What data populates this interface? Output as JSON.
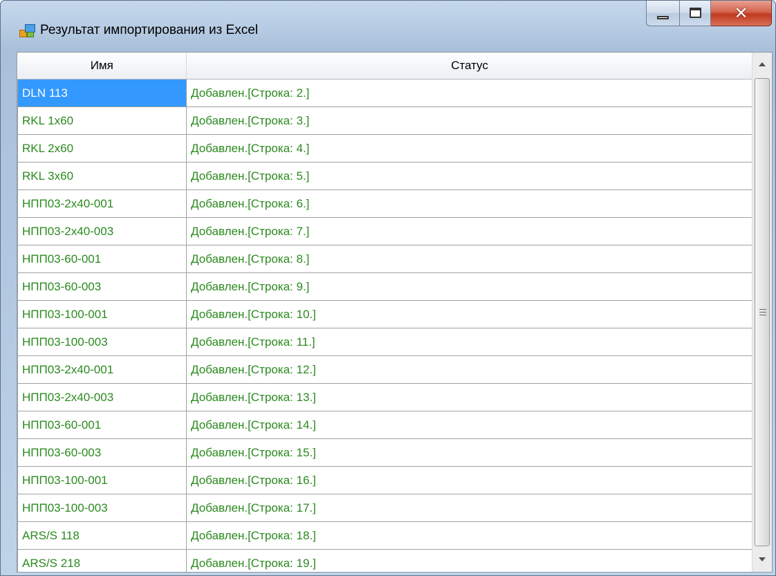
{
  "window": {
    "title": "Результат импортирования из Excel",
    "buttons": {
      "minimize": "minimize-icon",
      "maximize": "maximize-icon",
      "close": "✕"
    }
  },
  "grid": {
    "columns": [
      "Имя",
      "Статус"
    ],
    "selected_row": 0,
    "rows": [
      {
        "name": "DLN 113",
        "status": "Добавлен.[Строка: 2.]"
      },
      {
        "name": "RKL 1x60",
        "status": "Добавлен.[Строка: 3.]"
      },
      {
        "name": "RKL 2x60",
        "status": "Добавлен.[Строка: 4.]"
      },
      {
        "name": "RKL 3x60",
        "status": "Добавлен.[Строка: 5.]"
      },
      {
        "name": "НПП03-2x40-001",
        "status": "Добавлен.[Строка: 6.]"
      },
      {
        "name": "НПП03-2x40-003",
        "status": "Добавлен.[Строка: 7.]"
      },
      {
        "name": "НПП03-60-001",
        "status": "Добавлен.[Строка: 8.]"
      },
      {
        "name": "НПП03-60-003",
        "status": "Добавлен.[Строка: 9.]"
      },
      {
        "name": "НПП03-100-001",
        "status": "Добавлен.[Строка: 10.]"
      },
      {
        "name": "НПП03-100-003",
        "status": "Добавлен.[Строка: 11.]"
      },
      {
        "name": "НПП03-2x40-001",
        "status": "Добавлен.[Строка: 12.]"
      },
      {
        "name": "НПП03-2x40-003",
        "status": "Добавлен.[Строка: 13.]"
      },
      {
        "name": "НПП03-60-001",
        "status": "Добавлен.[Строка: 14.]"
      },
      {
        "name": "НПП03-60-003",
        "status": "Добавлен.[Строка: 15.]"
      },
      {
        "name": "НПП03-100-001",
        "status": "Добавлен.[Строка: 16.]"
      },
      {
        "name": "НПП03-100-003",
        "status": "Добавлен.[Строка: 17.]"
      },
      {
        "name": "ARS/S 118",
        "status": "Добавлен.[Строка: 18.]"
      },
      {
        "name": "ARS/S 218",
        "status": "Добавлен.[Строка: 19.]"
      }
    ]
  },
  "colors": {
    "status_text": "#2a8a1e",
    "selection": "#3399ff"
  },
  "icons": {
    "app": "app-window-icon",
    "scroll_up": "scroll-up-arrow-icon",
    "scroll_down": "scroll-down-arrow-icon",
    "thumb_grip": "scrollbar-grip-icon"
  }
}
